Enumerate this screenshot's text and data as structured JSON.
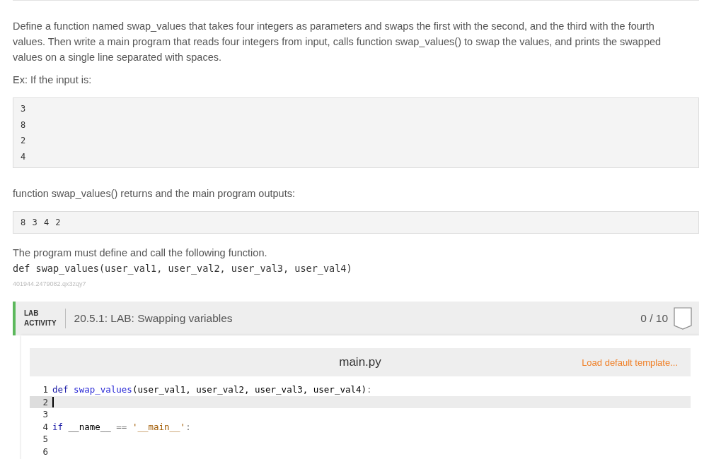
{
  "description": "Define a function named swap_values that takes four integers as parameters and swaps the first with the second, and the third with the fourth values. Then write a main program that reads four integers from input, calls function swap_values() to swap the values, and prints the swapped values on a single line separated with spaces.",
  "example_intro": "Ex: If the input is:",
  "example_input": [
    "3",
    "8",
    "2",
    "4"
  ],
  "output_intro": "function swap_values() returns and the main program outputs:",
  "example_output": "8 3 4 2",
  "requirement": "The program must define and call the following function.",
  "signature": "def swap_values(user_val1, user_val2, user_val3, user_val4)",
  "reference_id": "401944.2479082.qx3zqy7",
  "lab": {
    "tag_lines": [
      "LAB",
      "ACTIVITY"
    ],
    "title": "20.5.1: LAB: Swapping variables",
    "score": "0 / 10"
  },
  "editor": {
    "filename": "main.py",
    "template_link": "Load default template...",
    "lines": [
      {
        "number": "1",
        "selected": false,
        "tokens": [
          {
            "kind": "keyword",
            "text": "def "
          },
          {
            "kind": "function",
            "text": "swap_values"
          },
          {
            "kind": "plain",
            "text": "(user_val1, user_val2, user_val3, user_val4)"
          },
          {
            "kind": "operator",
            "text": ":"
          }
        ]
      },
      {
        "number": "2",
        "selected": true
      },
      {
        "number": "3",
        "selected": false
      },
      {
        "number": "4",
        "selected": false,
        "tokens": [
          {
            "kind": "keyword",
            "text": "if "
          },
          {
            "kind": "plain",
            "text": "__name__ "
          },
          {
            "kind": "operator",
            "text": "== "
          },
          {
            "kind": "string",
            "text": "'__main__'"
          },
          {
            "kind": "operator",
            "text": ":"
          }
        ]
      },
      {
        "number": "5",
        "selected": false
      },
      {
        "number": "6",
        "selected": false
      }
    ]
  }
}
